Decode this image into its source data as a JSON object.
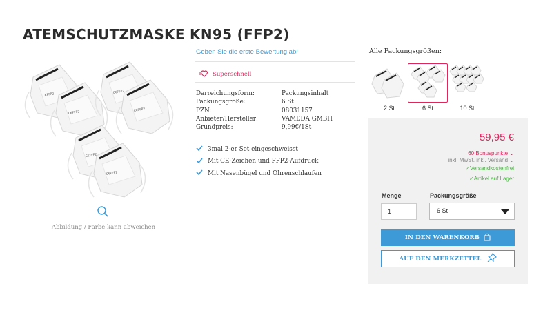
{
  "product": {
    "title": "ATEMSCHUTZMASKE KN95 (FFP2)",
    "image_caption": "Abbildung / Farbe kann abweichen"
  },
  "reviews": {
    "link": "Geben Sie die erste Bewertung ab!"
  },
  "badge": {
    "label": "Superschnell",
    "icon": "express-delivery-icon"
  },
  "specs": [
    {
      "label": "Darreichungsform:",
      "value": "Packungsinhalt"
    },
    {
      "label": "Packungsgröße:",
      "value": "6 St"
    },
    {
      "label": "PZN:",
      "value": "08031157"
    },
    {
      "label": "Anbieter/Hersteller:",
      "value": "VAMEDA GMBH"
    },
    {
      "label": "Grundpreis:",
      "value": "9,99€/1St"
    }
  ],
  "features": [
    "3mal 2-er Set eingeschweisst",
    "Mit CE-Zeichen und FFP2-Aufdruck",
    "Mit Nasenbügel und Ohrenschlaufen"
  ],
  "sizes": {
    "title": "Alle Packungsgrößen:",
    "options": [
      {
        "label": "2 St",
        "selected": false
      },
      {
        "label": "6 St",
        "selected": true
      },
      {
        "label": "10 St",
        "selected": false
      }
    ]
  },
  "buybox": {
    "price": "59,95 €",
    "bonus": "60 Bonuspunkte",
    "tax": "inkl. MwSt. inkl. Versand",
    "shipping": "Versandkostenfrei",
    "stock": "Artikel auf Lager",
    "qty_label": "Menge",
    "qty_value": "1",
    "pack_label": "Packungsgröße",
    "pack_selected": "6 St",
    "cart_button": "IN DEN WARENKORB",
    "wish_button": "AUF DEN MERKZETTEL"
  },
  "colors": {
    "accent": "#3e9ad6",
    "price": "#e0245e",
    "success": "#4bb543",
    "buybox_bg": "#f1f1f1"
  }
}
